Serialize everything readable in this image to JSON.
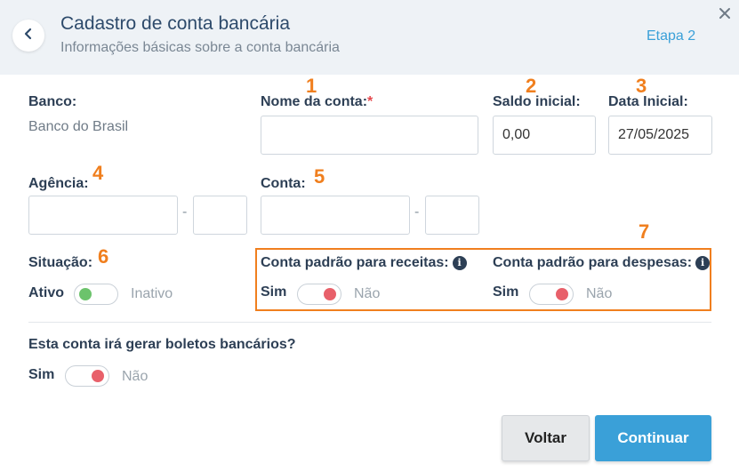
{
  "header": {
    "title": "Cadastro de conta bancária",
    "subtitle": "Informações básicas sobre a conta bancária",
    "step": "Etapa 2"
  },
  "bank": {
    "label": "Banco:",
    "value": "Banco do Brasil"
  },
  "account_name": {
    "label": "Nome da conta:",
    "required_mark": "*",
    "value": ""
  },
  "initial_balance": {
    "label": "Saldo inicial:",
    "value": "0,00"
  },
  "initial_date": {
    "label": "Data Inicial:",
    "value": "27/05/2025"
  },
  "agency": {
    "label": "Agência:",
    "value": "",
    "digit": "",
    "separator": "-"
  },
  "account": {
    "label": "Conta:",
    "value": "",
    "digit": "",
    "separator": "-"
  },
  "status": {
    "label": "Situação:",
    "on_label": "Ativo",
    "off_label": "Inativo",
    "enabled": true,
    "knob_color": "#6cc36c"
  },
  "default_income": {
    "label": "Conta padrão para receitas:",
    "on_label": "Sim",
    "off_label": "Não",
    "enabled": false,
    "knob_color": "#e8606a"
  },
  "default_expense": {
    "label": "Conta padrão para despesas:",
    "on_label": "Sim",
    "off_label": "Não",
    "enabled": false,
    "knob_color": "#e8606a"
  },
  "boletos": {
    "label": "Esta conta irá gerar boletos bancários?",
    "on_label": "Sim",
    "off_label": "Não",
    "enabled": false,
    "knob_color": "#e8606a"
  },
  "annotations": [
    "1",
    "2",
    "3",
    "4",
    "5",
    "6",
    "7"
  ],
  "buttons": {
    "back": "Voltar",
    "continue": "Continuar"
  },
  "colors": {
    "accent": "#3aa0d8",
    "annotation": "#f07f1e",
    "header_bg": "#eef2f6"
  },
  "icons": [
    "chevron-left-icon",
    "close-icon",
    "info-icon"
  ]
}
